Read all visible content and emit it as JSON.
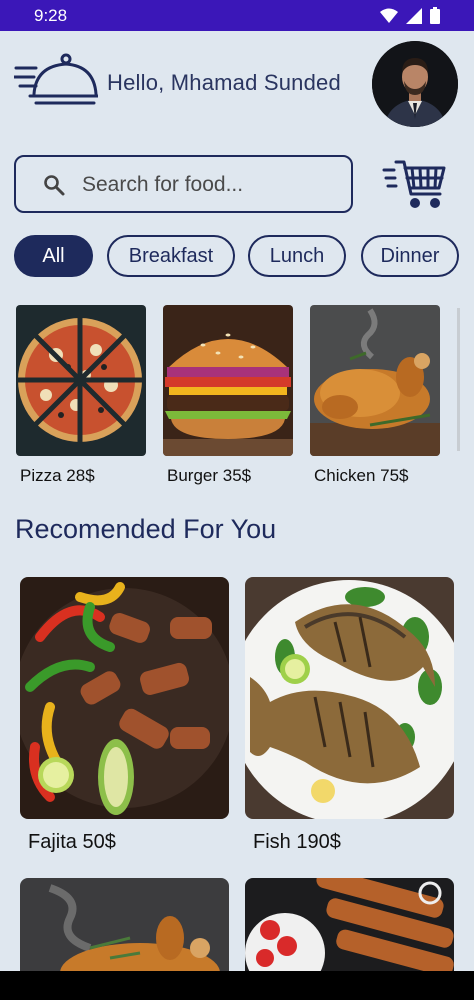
{
  "status": {
    "time": "9:28"
  },
  "header": {
    "greeting": "Hello, Mhamad Sunded"
  },
  "search": {
    "placeholder": "Search for food..."
  },
  "categories": [
    {
      "label": "All",
      "active": true
    },
    {
      "label": "Breakfast",
      "active": false
    },
    {
      "label": "Lunch",
      "active": false
    },
    {
      "label": "Dinner",
      "active": false
    }
  ],
  "featured": [
    {
      "label": "Pizza 28$"
    },
    {
      "label": "Burger 35$"
    },
    {
      "label": "Chicken 75$"
    }
  ],
  "recommended": {
    "title": "Recomended For You",
    "items": [
      {
        "label": "Fajita 50$"
      },
      {
        "label": "Fish 190$"
      }
    ]
  },
  "colors": {
    "status_bar": "#3b17b8",
    "accent": "#1e2a5c",
    "background": "#dfe7ef"
  }
}
